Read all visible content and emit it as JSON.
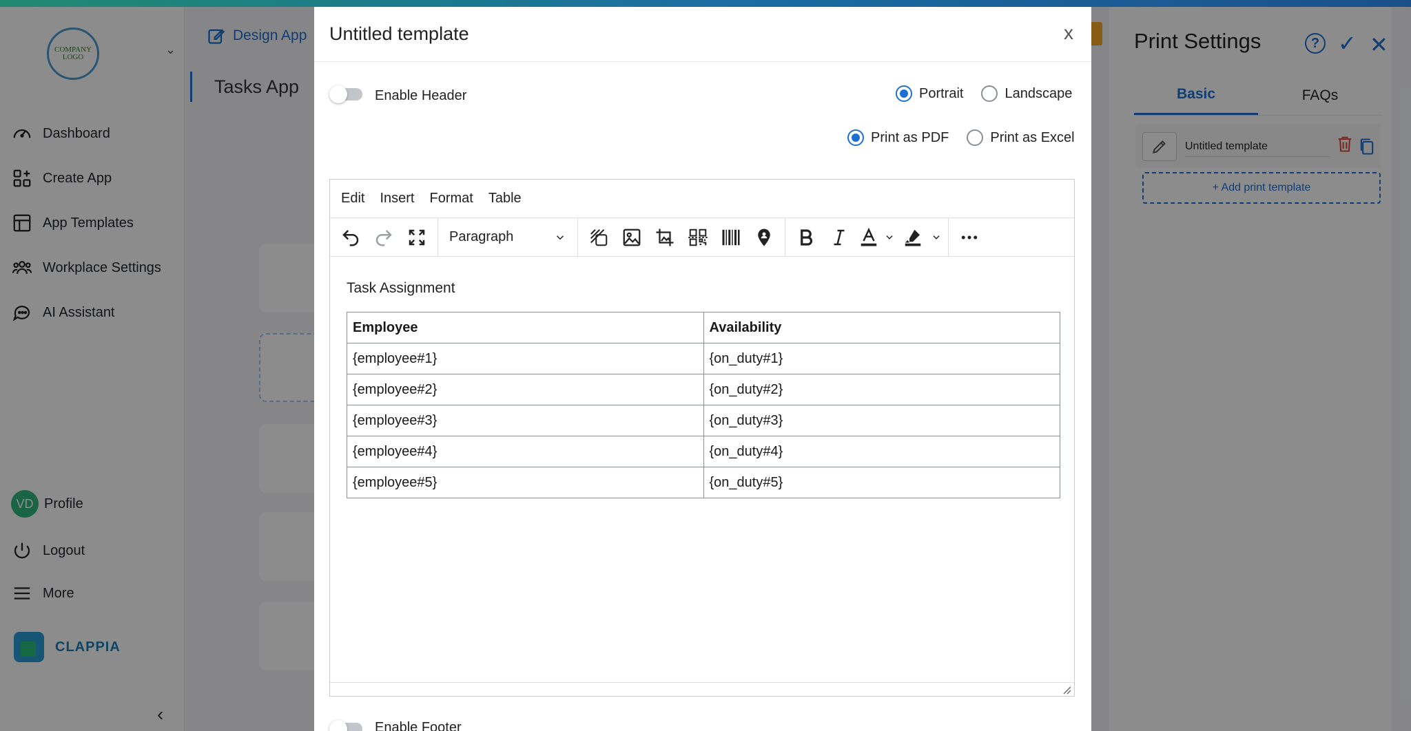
{
  "sidebar": {
    "logo_text": "COMPANY LOGO",
    "items": [
      {
        "label": "Dashboard"
      },
      {
        "label": "Create App"
      },
      {
        "label": "App Templates"
      },
      {
        "label": "Workplace Settings"
      },
      {
        "label": "AI Assistant"
      }
    ],
    "profile": {
      "initials": "VD",
      "label": "Profile"
    },
    "logout_label": "Logout",
    "more_label": "More",
    "brand_name": "CLAPPIA"
  },
  "main": {
    "design_label": "Design App",
    "app_title": "Tasks App"
  },
  "print_settings": {
    "title": "Print Settings",
    "help_symbol": "?",
    "tabs": [
      {
        "label": "Basic"
      },
      {
        "label": "FAQs"
      }
    ],
    "template_name": "Untitled template",
    "add_template_label": "+ Add print template"
  },
  "modal": {
    "title": "Untitled template",
    "close_label": "x",
    "enable_header_label": "Enable Header",
    "enable_footer_label": "Enable Footer",
    "orientation": {
      "portrait": "Portrait",
      "landscape": "Landscape",
      "selected": "Portrait"
    },
    "format": {
      "pdf": "Print as PDF",
      "excel": "Print as Excel",
      "selected": "Print as PDF"
    },
    "editor": {
      "menu": [
        "Edit",
        "Insert",
        "Format",
        "Table"
      ],
      "block_format": "Paragraph",
      "heading": "Task Assignment",
      "table": {
        "headers": [
          "Employee",
          "Availability"
        ],
        "rows": [
          [
            "{employee#1}",
            "{on_duty#1}"
          ],
          [
            "{employee#2}",
            "{on_duty#2}"
          ],
          [
            "{employee#3}",
            "{on_duty#3}"
          ],
          [
            "{employee#4}",
            "{on_duty#4}"
          ],
          [
            "{employee#5}",
            "{on_duty#5}"
          ]
        ]
      }
    }
  },
  "colors": {
    "accent": "#1d6fd1",
    "brand_green": "#2cb67d",
    "danger": "#e5483f"
  }
}
